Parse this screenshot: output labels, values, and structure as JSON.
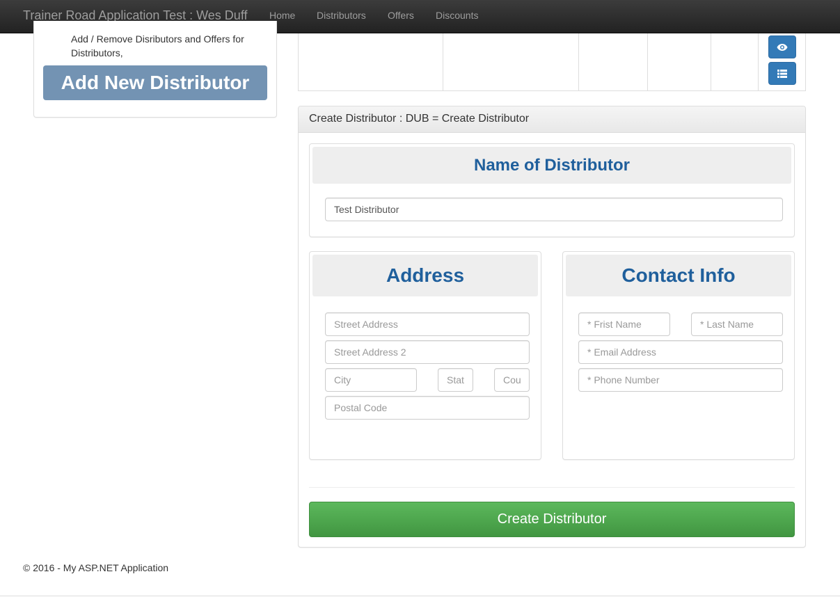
{
  "navbar": {
    "brand": "Trainer Road Application Test : Wes Duff",
    "links": [
      "Home",
      "Distributors",
      "Offers",
      "Discounts"
    ]
  },
  "sidebar": {
    "description": "Add / Remove Disributors and Offers for Distributors,",
    "add_button_label": "Add New Distributor"
  },
  "table": {
    "icons": [
      "eye-icon",
      "list-icon"
    ]
  },
  "form_panel": {
    "heading": "Create Distributor : DUB = Create Distributor",
    "name_section": {
      "title": "Name of Distributor",
      "name_value": "Test Distributor"
    },
    "address_section": {
      "title": "Address",
      "street_placeholder": "Street Address",
      "street2_placeholder": "Street Address 2",
      "city_placeholder": "City",
      "state_placeholder": "Stat",
      "country_placeholder": "Cou",
      "postal_placeholder": "Postal Code"
    },
    "contact_section": {
      "title": "Contact Info",
      "first_name_placeholder": "* Frist Name",
      "last_name_placeholder": "* Last Name",
      "email_placeholder": "* Email Address",
      "phone_placeholder": "* Phone Number"
    },
    "submit_label": "Create Distributor"
  },
  "footer": {
    "text": "© 2016 - My ASP.NET Application"
  },
  "colors": {
    "navbar_bg": "#222222",
    "primary": "#337ab7",
    "success": "#5cb85c",
    "section_title": "#1f5f9c",
    "add_button": "#7393b3"
  }
}
